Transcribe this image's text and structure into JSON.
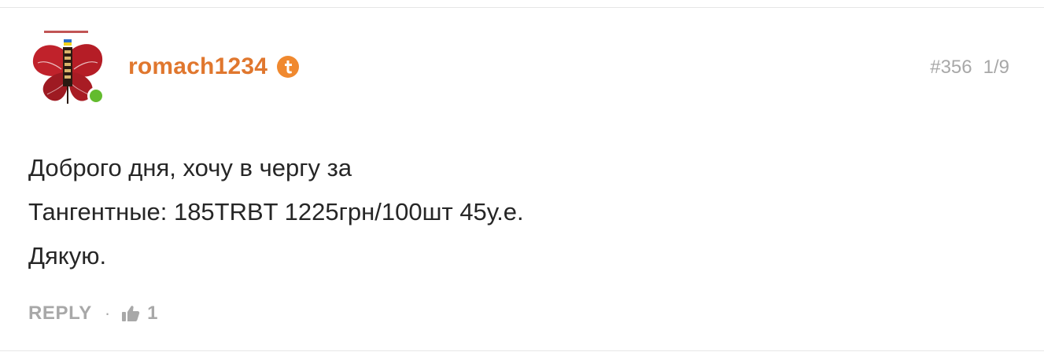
{
  "comment": {
    "author": {
      "username": "romach1234",
      "avatar_icon": "poppy-avatar-icon",
      "badge_icon": "t-badge-icon",
      "online": true
    },
    "meta": {
      "number": "#356",
      "page": "1/9"
    },
    "body": [
      "Доброго дня, хочу в чергу за",
      "Тангентные: 185TRBT 1225грн/100шт 45у.е.",
      "Дякую."
    ],
    "footer": {
      "reply_label": "REPLY",
      "separator": "·",
      "like_icon": "thumbs-up-icon",
      "like_count": "1"
    }
  },
  "colors": {
    "username": "#e0772e",
    "badge": "#f0892f",
    "online": "#63bb2e",
    "muted": "#a8a8a8",
    "text": "#262626",
    "divider": "#e6e6e6"
  }
}
